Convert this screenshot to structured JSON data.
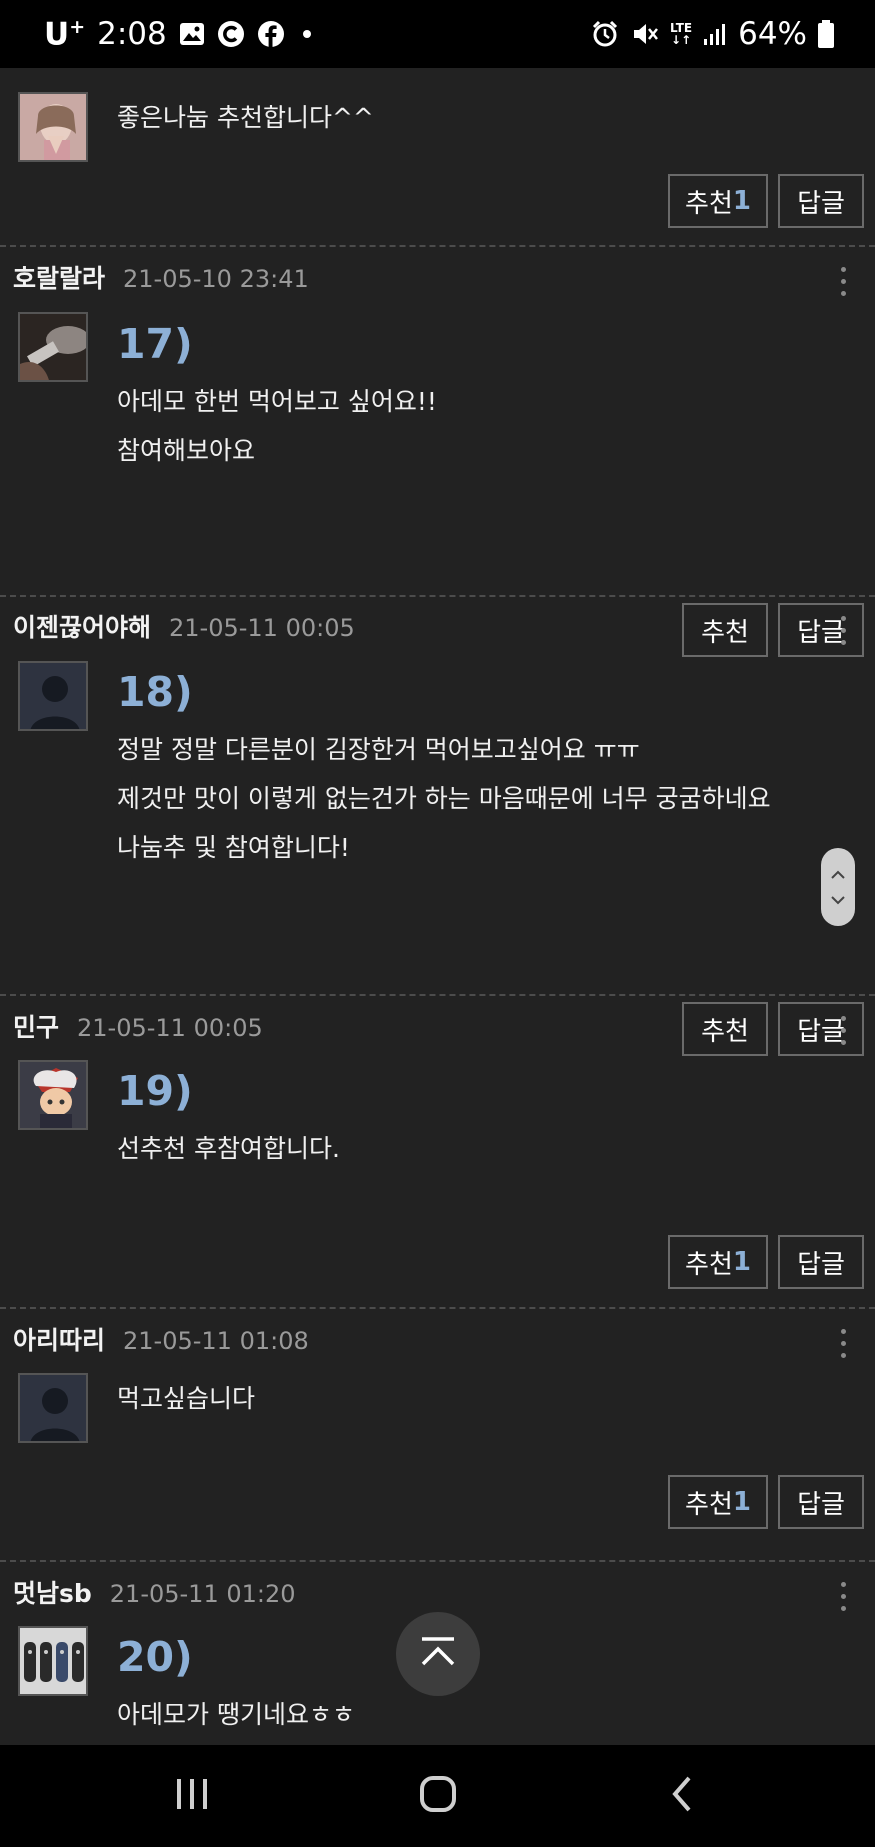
{
  "status_bar": {
    "carrier": "U",
    "carrier_sup": "+",
    "time": "2:08",
    "network": "LTE",
    "battery": "64%"
  },
  "comments": [
    {
      "author": "",
      "date": "",
      "number": "",
      "lines": [
        "좋은나눔 추천합니다^^"
      ],
      "like_label": "추천",
      "like_count": "1",
      "reply_label": "답글"
    },
    {
      "author": "호랄랄라",
      "date": "21-05-10 23:41",
      "number": "17)",
      "lines": [
        "아데모 한번 먹어보고 싶어요!!",
        "참여해보아요"
      ],
      "like_label": "추천",
      "like_count": "",
      "reply_label": "답글"
    },
    {
      "author": "이젠끊어야해",
      "date": "21-05-11 00:05",
      "number": "18)",
      "lines": [
        "정말 정말 다른분이 김장한거 먹어보고싶어요 ㅠㅠ",
        "제것만 맛이 이렇게 없는건가 하는 마음때문에 너무 궁굼하네요",
        "나눔추 및 참여합니다!"
      ],
      "like_label": "추천",
      "like_count": "",
      "reply_label": "답글"
    },
    {
      "author": "민구",
      "date": "21-05-11 00:05",
      "number": "19)",
      "lines": [
        "선추천 후참여합니다."
      ],
      "like_label": "추천",
      "like_count": "1",
      "reply_label": "답글"
    },
    {
      "author": "아리따리",
      "date": "21-05-11 01:08",
      "number": "",
      "lines": [
        "먹고싶습니다"
      ],
      "like_label": "추천",
      "like_count": "1",
      "reply_label": "답글"
    },
    {
      "author": "멋남sb",
      "date": "21-05-11 01:20",
      "number": "20)",
      "lines": [
        "아데모가 땡기네요ㅎㅎ"
      ],
      "like_label": "",
      "like_count": "",
      "reply_label": ""
    }
  ],
  "icons": {
    "status": [
      "gallery-icon",
      "c-app-icon",
      "facebook-icon",
      "dot-icon",
      "alarm-icon",
      "mute-icon",
      "signal-icon",
      "battery-icon"
    ],
    "nav": [
      "recents-icon",
      "home-icon",
      "back-icon"
    ],
    "float": [
      "scroll-top-icon"
    ]
  },
  "colors": {
    "background": "#222222",
    "accent_number": "#8db0d6",
    "date_text": "#9a9a9a"
  }
}
